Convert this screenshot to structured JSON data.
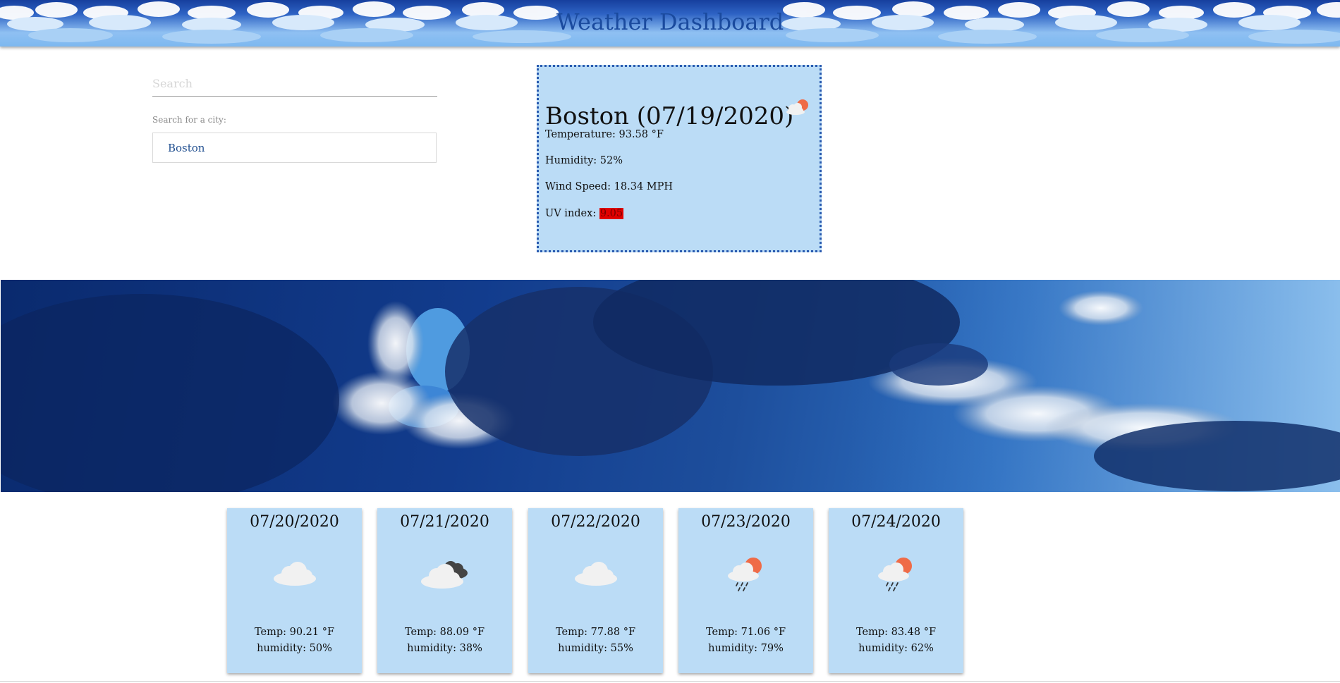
{
  "header": {
    "title": "Weather Dashboard"
  },
  "search": {
    "placeholder": "Search",
    "label": "Search for a city:",
    "cities": [
      "Boston"
    ]
  },
  "current": {
    "title": "Boston (07/19/2020)",
    "icon": "partly-cloudy-icon",
    "temperature": "Temperature: 93.58 °F",
    "humidity": "Humidity: 52%",
    "wind": "Wind Speed: 18.34 MPH",
    "uv_label": "UV index: ",
    "uv_value": "9.05",
    "uv_color": "#e00000"
  },
  "forecast": [
    {
      "date": "07/20/2020",
      "icon": "cloud-icon",
      "temp": "Temp: 90.21 °F",
      "humidity": "humidity: 50%"
    },
    {
      "date": "07/21/2020",
      "icon": "broken-clouds-icon",
      "temp": "Temp: 88.09 °F",
      "humidity": "humidity: 38%"
    },
    {
      "date": "07/22/2020",
      "icon": "cloud-icon",
      "temp": "Temp: 77.88 °F",
      "humidity": "humidity: 55%"
    },
    {
      "date": "07/23/2020",
      "icon": "sun-rain-icon",
      "temp": "Temp: 71.06 °F",
      "humidity": "humidity: 79%"
    },
    {
      "date": "07/24/2020",
      "icon": "sun-rain-icon",
      "temp": "Temp: 83.48 °F",
      "humidity": "humidity: 62%"
    }
  ],
  "colors": {
    "card_background": "#bbdcf6",
    "card_border": "#2a5bb0",
    "header_title": "#1a4a9e",
    "city_text": "#1f4e8f"
  }
}
